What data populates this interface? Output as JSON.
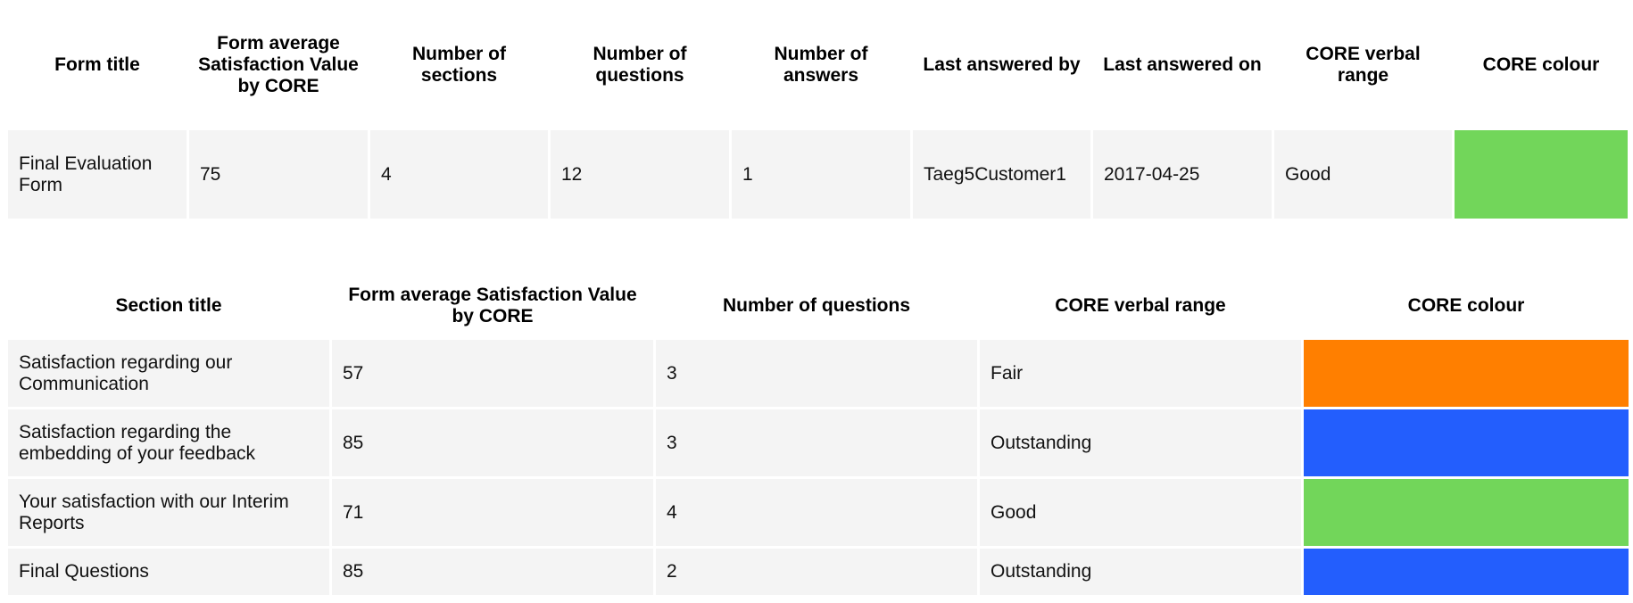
{
  "form_table": {
    "headers": {
      "form_title": "Form title",
      "avg_satisfaction": "Form average Satisfaction Value by CORE",
      "num_sections": "Number of sections",
      "num_questions": "Number of questions",
      "num_answers": "Number of answers",
      "last_answered_by": "Last answered by",
      "last_answered_on": "Last answered on",
      "core_verbal_range": "CORE verbal range",
      "core_colour": "CORE colour"
    },
    "row": {
      "form_title": "Final Evaluation Form",
      "avg_satisfaction": "75",
      "num_sections": "4",
      "num_questions": "12",
      "num_answers": "1",
      "last_answered_by": "Taeg5Customer1",
      "last_answered_on": "2017-04-25",
      "core_verbal_range": "Good",
      "core_colour": "#72d65a"
    }
  },
  "section_table": {
    "headers": {
      "section_title": "Section title",
      "avg_satisfaction": "Form average Satisfaction Value by CORE",
      "num_questions": "Number of questions",
      "core_verbal_range": "CORE verbal range",
      "core_colour": "CORE colour"
    },
    "rows": [
      {
        "section_title": "Satisfaction regarding our Communication",
        "avg_satisfaction": "57",
        "num_questions": "3",
        "core_verbal_range": "Fair",
        "core_colour": "#ff7f00"
      },
      {
        "section_title": "Satisfaction regarding the embedding of your feedback",
        "avg_satisfaction": "85",
        "num_questions": "3",
        "core_verbal_range": "Outstanding",
        "core_colour": "#235efd"
      },
      {
        "section_title": "Your satisfaction with our Interim Reports",
        "avg_satisfaction": "71",
        "num_questions": "4",
        "core_verbal_range": "Good",
        "core_colour": "#72d65a"
      },
      {
        "section_title": "Final Questions",
        "avg_satisfaction": "85",
        "num_questions": "2",
        "core_verbal_range": "Outstanding",
        "core_colour": "#235efd"
      }
    ]
  }
}
